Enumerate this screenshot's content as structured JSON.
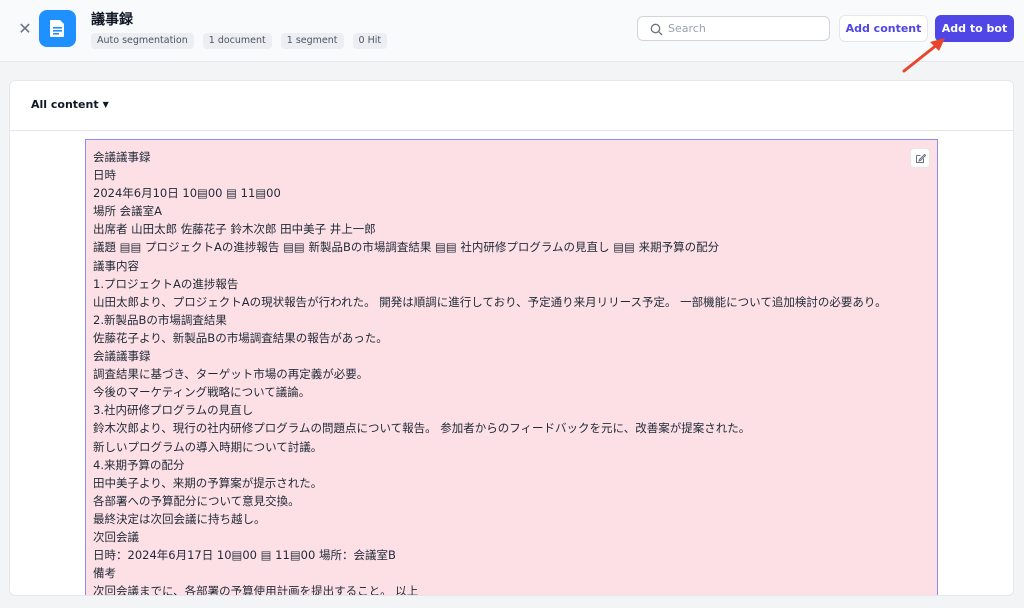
{
  "header": {
    "title": "議事録",
    "badges": [
      "Auto segmentation",
      "1 document",
      "1 segment",
      "0 Hit"
    ],
    "search_placeholder": "Search",
    "add_content_label": "Add content",
    "add_to_bot_label": "Add to bot"
  },
  "filter": {
    "label": "All content"
  },
  "segment": {
    "lines": [
      "会議議事録",
      "日時",
      "2024年6月10日 10▤00 ▤ 11▤00",
      "場所 会議室A",
      "出席者 山田太郎 佐藤花子 鈴木次郎 田中美子 井上一郎",
      "議題 ▤▤ プロジェクトAの進捗報告 ▤▤ 新製品Bの市場調査結果 ▤▤ 社内研修プログラムの見直し ▤▤ 来期予算の配分",
      "議事内容",
      "1.プロジェクトAの進捗報告",
      "山田太郎より、プロジェクトAの現状報告が行われた。 開発は順調に進行しており、予定通り来月リリース予定。 一部機能について追加検討の必要あり。",
      "2.新製品Bの市場調査結果",
      "佐藤花子より、新製品Bの市場調査結果の報告があった。",
      "会議議事録",
      "調査結果に基づき、ターゲット市場の再定義が必要。",
      "今後のマーケティング戦略について議論。",
      "3.社内研修プログラムの見直し",
      "鈴木次郎より、現行の社内研修プログラムの問題点について報告。 参加者からのフィードバックを元に、改善案が提案された。",
      "新しいプログラムの導入時期について討議。",
      "4.来期予算の配分",
      "田中美子より、来期の予算案が提示された。",
      "各部署への予算配分について意見交換。",
      "最終決定は次回会議に持ち越し。",
      "次回会議",
      "日時：2024年6月17日 10▤00 ▤ 11▤00 場所：会議室B",
      "備考",
      "次回会議までに、各部署の予算使用計画を提出すること。 以上"
    ]
  },
  "colors": {
    "accent": "#4f46e5",
    "doc_tile": "#1e90ff",
    "segment_bg": "#fde0e6",
    "annotation_arrow": "#e8452c"
  }
}
